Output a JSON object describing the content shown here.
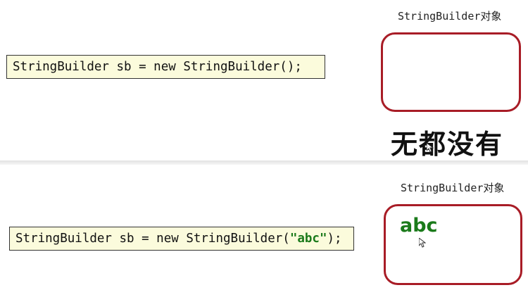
{
  "top": {
    "object_label": "StringBuilder对象",
    "code_before": "StringBuilder sb = new StringBuilder();",
    "watermark_text": "无都没有"
  },
  "bottom": {
    "object_label": "StringBuilder对象",
    "code_before": "StringBuilder sb = new StringBuilder(",
    "code_string": "\"abc\"",
    "code_after": ");",
    "object_content": "abc"
  },
  "colors": {
    "object_border": "#a81c26",
    "code_background": "#fbfbdc",
    "string_literal": "#1a7a1a"
  },
  "icons": [
    "mouse-cursor-icon"
  ]
}
